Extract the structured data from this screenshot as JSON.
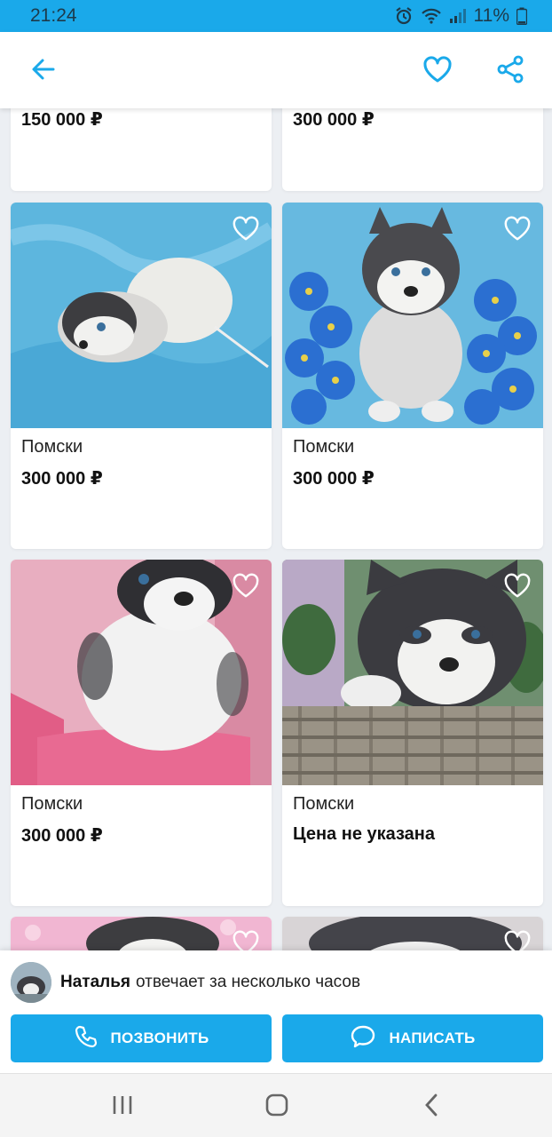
{
  "status_bar": {
    "time": "21:24",
    "battery": "11%"
  },
  "app_bar": {
    "icons": [
      "back-arrow-icon",
      "heart-outline-icon",
      "share-icon"
    ],
    "accent_color": "#1aa9ea"
  },
  "listings": [
    {
      "title": "",
      "price": "150 000 ₽"
    },
    {
      "title": "",
      "price": "300 000 ₽"
    },
    {
      "title": "Помски",
      "price": "300 000 ₽"
    },
    {
      "title": "Помски",
      "price": "300 000 ₽"
    },
    {
      "title": "Помски",
      "price": "300 000 ₽"
    },
    {
      "title": "Помски",
      "price": "Цена не указана"
    }
  ],
  "contact": {
    "seller_name": "Наталья",
    "seller_status": "отвечает за несколько часов",
    "call_label": "ПОЗВОНИТЬ",
    "write_label": "НАПИСАТЬ"
  },
  "nav_bar": {
    "icons": [
      "recents-icon",
      "home-icon",
      "back-icon"
    ]
  }
}
